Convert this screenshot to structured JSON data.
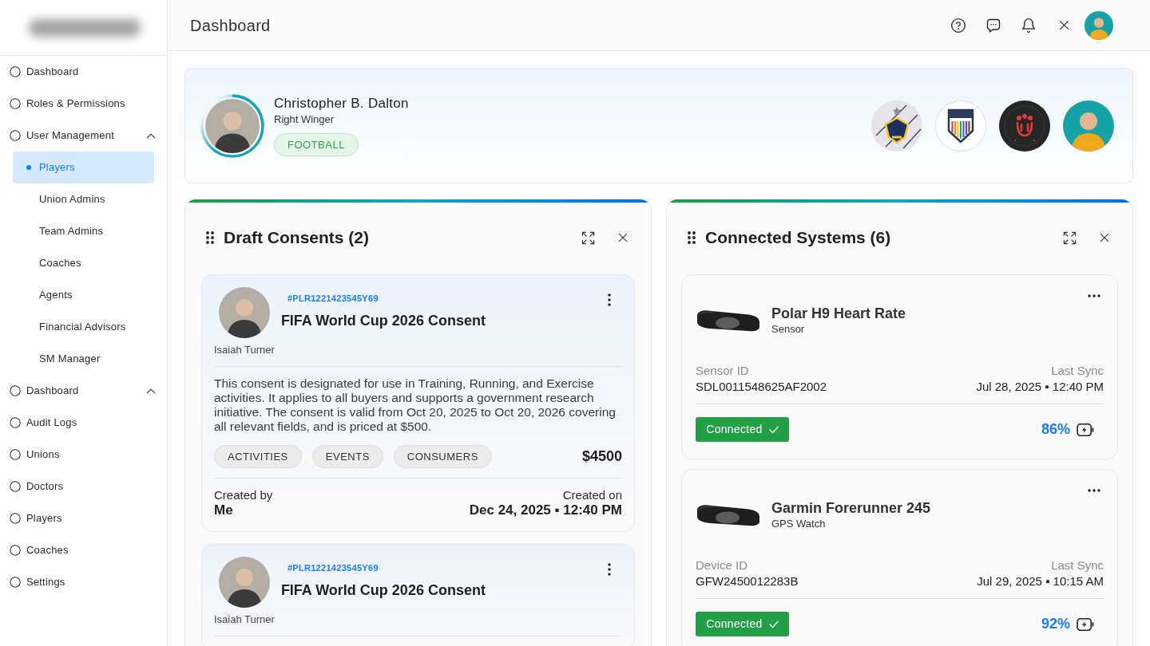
{
  "sidebar": {
    "items": [
      {
        "kind": "link",
        "label": "Dashboard",
        "selected": false
      },
      {
        "kind": "link",
        "label": "Roles & Permissions",
        "selected": false
      },
      {
        "kind": "group",
        "label": "User Management",
        "selected": false,
        "expanded": true,
        "children": [
          {
            "label": "Players",
            "selected": true
          },
          {
            "label": "Union Admins",
            "selected": false
          },
          {
            "label": "Team Admins",
            "selected": false
          },
          {
            "label": "Coaches",
            "selected": false
          },
          {
            "label": "Agents",
            "selected": false
          },
          {
            "label": "Financial Advisors",
            "selected": false
          },
          {
            "label": "SM Manager",
            "selected": false
          }
        ]
      },
      {
        "kind": "group",
        "label": "Dashboard",
        "selected": false,
        "expanded": true
      },
      {
        "kind": "link",
        "label": "Audit Logs",
        "selected": false
      },
      {
        "kind": "link",
        "label": "Unions",
        "selected": false
      },
      {
        "kind": "link",
        "label": "Doctors",
        "selected": false
      },
      {
        "kind": "link",
        "label": "Players",
        "selected": false
      },
      {
        "kind": "link",
        "label": "Coaches",
        "selected": false
      },
      {
        "kind": "link",
        "label": "Settings",
        "selected": false
      }
    ]
  },
  "header": {
    "title": "Dashboard"
  },
  "profile": {
    "name": "Christopher B. Dalton",
    "position": "Right Winger",
    "sport": "FOOTBALL"
  },
  "draft_consents": {
    "title": "Draft Consents (2)",
    "cards": [
      {
        "player": "Isaiah Turner",
        "id": "#PLR1221423545Y69",
        "title": "FIFA World Cup 2026 Consent",
        "description": "This consent is designated for use in Training, Running, and Exercise activities. It applies to all buyers and supports a government research initiative. The consent is valid from Oct 20, 2025 to Oct 20, 2026 covering all relevant fields, and is priced at $500.",
        "tags": [
          "ACTIVITIES",
          "EVENTS",
          "CONSUMERS"
        ],
        "price": "$4500",
        "created_by_label": "Created by",
        "created_by": "Me",
        "created_on_label": "Created on",
        "created_on": "Dec 24, 2025 ▪ 12:40 PM"
      },
      {
        "player": "Isaiah Turner",
        "id": "#PLR1221423545Y69",
        "title": "FIFA World Cup 2026 Consent"
      }
    ]
  },
  "connected_systems": {
    "title": "Connected Systems (6)",
    "cards": [
      {
        "name": "Polar H9 Heart Rate",
        "type": "Sensor",
        "id_label": "Sensor ID",
        "id": "SDL0011548625AF2002",
        "sync_label": "Last Sync",
        "sync": "Jul 28, 2025 ▪ 12:40 PM",
        "status": "Connected",
        "connected": true,
        "battery": "86%"
      },
      {
        "name": "Garmin Forerunner 245",
        "type": "GPS Watch",
        "id_label": "Device ID",
        "id": "GFW2450012283B",
        "sync_label": "Last Sync",
        "sync": "Jul 29, 2025 ▪ 10:15 AM",
        "status": "Connected",
        "connected": true,
        "battery": "92%"
      }
    ]
  }
}
